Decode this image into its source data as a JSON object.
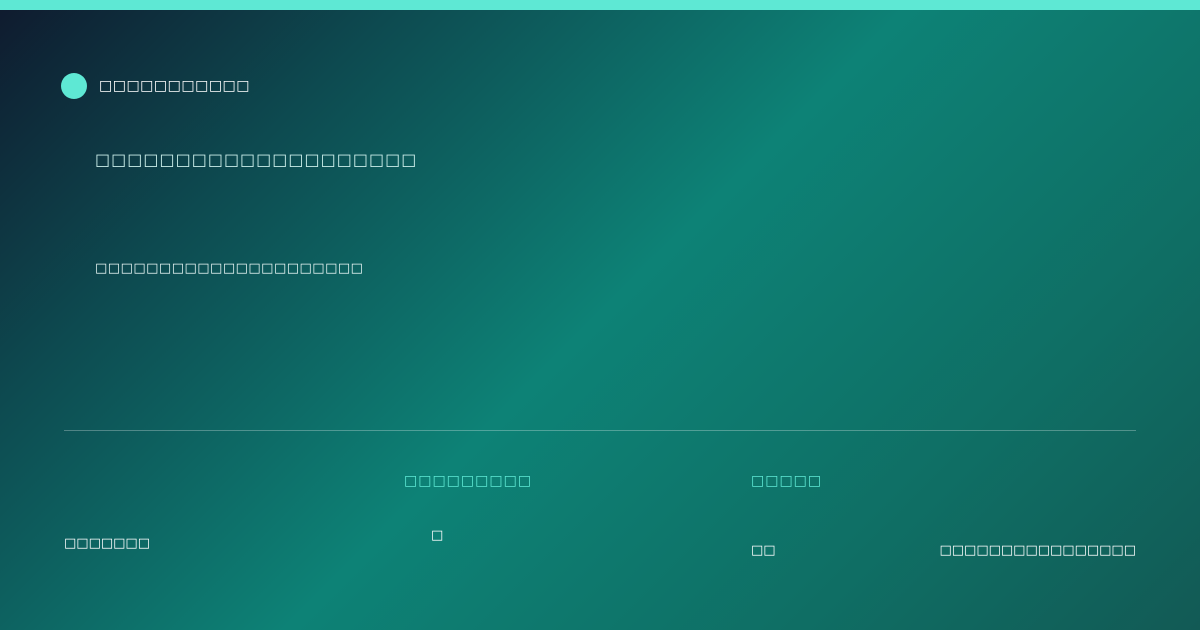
{
  "colors": {
    "accent": "#5ee8d4"
  },
  "brand": {
    "icon": "brand-dot-icon",
    "name": "□□□□□□□□□□□"
  },
  "hero": {
    "headline": "□□□□□□□□□□□□□□□□□□□□",
    "subline": "□□□□□□□□□□□□□□□□□□□□□"
  },
  "footer": {
    "left_text": "□□□□□□□",
    "stats": [
      {
        "label": "□□□□□□□□□",
        "value": "□"
      },
      {
        "label": "□□□□□",
        "value": "□□"
      }
    ],
    "right_text": "□□□□□□□□□□□□□□□□"
  }
}
